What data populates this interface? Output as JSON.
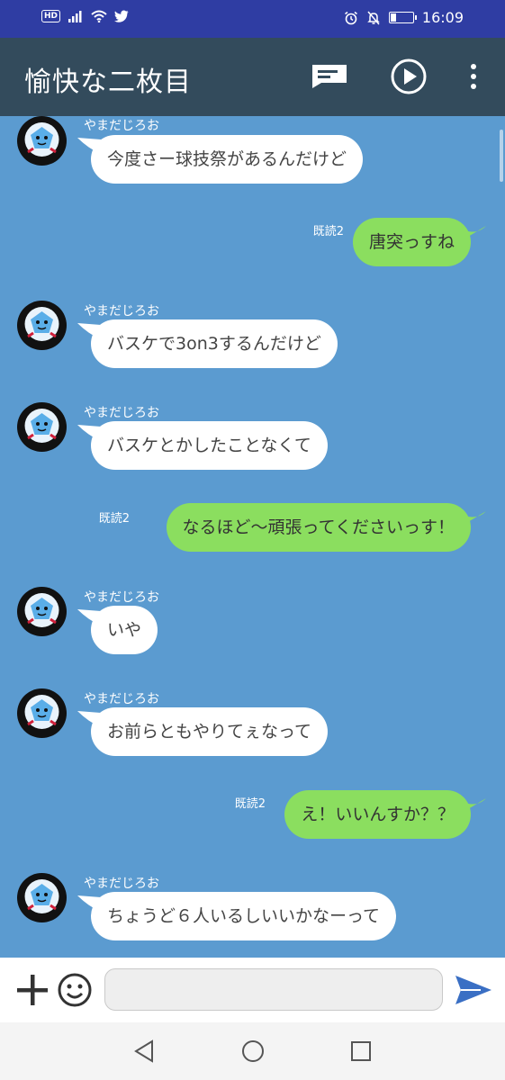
{
  "status_bar": {
    "hd_label": "HD",
    "time": "16:09",
    "battery_level": 0.25,
    "left_icons": [
      "hd-icon",
      "signal-icon",
      "wifi-icon",
      "twitter-icon"
    ],
    "right_icons": [
      "alarm-icon",
      "notifications-off-icon",
      "battery-icon"
    ]
  },
  "app_bar": {
    "title": "愉快な二枚目",
    "actions": [
      "chat-bubble-icon",
      "play-icon",
      "more-vert-icon"
    ]
  },
  "messages": [
    {
      "direction": "in",
      "sender": "やまだじろお",
      "text": "今度さー球技祭があるんだけど"
    },
    {
      "direction": "out",
      "read": "既読2",
      "text": "唐突っすね"
    },
    {
      "direction": "in",
      "sender": "やまだじろお",
      "text": "バスケで3on3するんだけど"
    },
    {
      "direction": "in",
      "sender": "やまだじろお",
      "text": "バスケとかしたことなくて"
    },
    {
      "direction": "out",
      "read": "既読2",
      "text": "なるほど～頑張ってくださいっす！"
    },
    {
      "direction": "in",
      "sender": "やまだじろお",
      "text": "いや"
    },
    {
      "direction": "in",
      "sender": "やまだじろお",
      "text": "お前らともやりてぇなって"
    },
    {
      "direction": "out",
      "read": "既読2",
      "text": "え！いいんすか？？"
    },
    {
      "direction": "in",
      "sender": "やまだじろお",
      "text": "ちょうど６人いるしいいかなーって"
    }
  ],
  "input": {
    "value": "",
    "placeholder": ""
  },
  "bottom_icons": [
    "plus-icon",
    "emoji-icon",
    "send-icon"
  ],
  "nav_icons": [
    "back-icon",
    "home-icon",
    "recents-icon"
  ],
  "colors": {
    "status_bar": "#2f3da3",
    "app_bar": "#334b5c",
    "chat_background": "#5b9bd0",
    "incoming_bubble": "#ffffff",
    "outgoing_bubble": "#8bde5f",
    "send_icon": "#3a6fc4"
  }
}
